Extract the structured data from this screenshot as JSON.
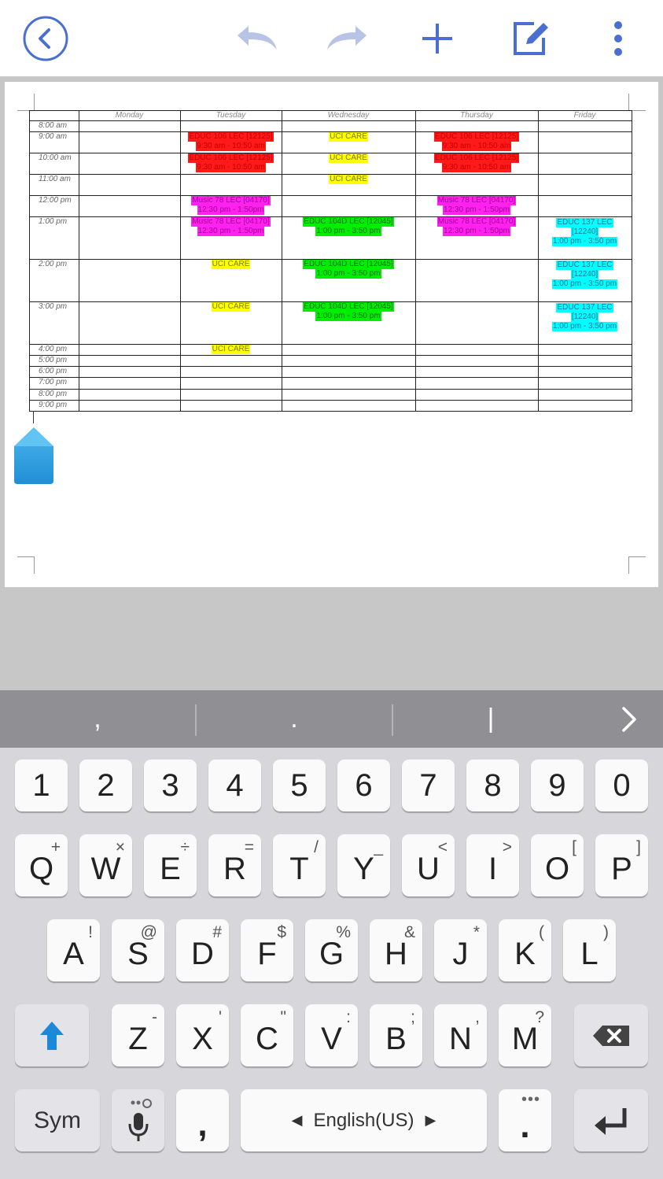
{
  "toolbar": {
    "icons": [
      "back-circle-icon",
      "undo-icon",
      "redo-icon",
      "add-icon",
      "edit-note-icon",
      "more-vert-icon"
    ],
    "accent": "#4a6fd0",
    "disabled": "#b7c4e6"
  },
  "schedule": {
    "days": [
      "Monday",
      "Tuesday",
      "Wednesday",
      "Thursday",
      "Friday"
    ],
    "times": [
      "8:00 am",
      "9:00 am",
      "10:00 am",
      "11:00 am",
      "12:00 pm",
      "1:00 pm",
      "2:00 pm",
      "3:00 pm",
      "4:00 pm",
      "5:00 pm",
      "6:00 pm",
      "7:00 pm",
      "8:00 pm",
      "9:00 pm"
    ],
    "events": {
      "tue_9_l1": "EDUC 106 LEC [12125]",
      "tue_9_l2": "9:30 am  -  10:50 am",
      "tue_10_l1": "EDUC 106 LEC [12125]",
      "tue_10_l2": "9:30 am  -  10:50 am",
      "tue_12_l1": "Music 78 LEC [04170]",
      "tue_12_l2": "12:30 pm  -  1:50pm",
      "tue_1_l1": "Music 78 LEC [04170]",
      "tue_1_l2": "12:30 pm  -  1:50pm",
      "tue_2": "UCI CARE",
      "tue_3": "UCI CARE",
      "tue_4": "UCI CARE",
      "wed_9": "UCI CARE",
      "wed_10": "UCI CARE",
      "wed_11": "UCI CARE",
      "wed_1_l1": "EDUC 104D LEC [12045]",
      "wed_1_l2": "1:00 pm  -  3:50 pm",
      "wed_2_l1": "EDUC 104D LEC [12045]",
      "wed_2_l2": "1:00 pm  -  3:50 pm",
      "wed_3_l1": "EDUC 104D LEC [12045]",
      "wed_3_l2": "1:00 pm  -  3:50 pm",
      "thu_9_l1": "EDUC 106 LEC [12125]",
      "thu_9_l2": "9:30 am  -  10:50 am",
      "thu_10_l1": "EDUC 106 LEC [12125]",
      "thu_10_l2": "9:30 am  -  10:50 am",
      "thu_12_l1": "Music 78 LEC [04170]",
      "thu_12_l2": "12:30 pm  -  1:50pm",
      "thu_1_l1": "Music 78 LEC [04170]",
      "thu_1_l2": "12:30 pm  -  1:50pm",
      "fri_1_l1": "EDUC 137 LEC",
      "fri_1_l2": "[12240]",
      "fri_1_l3": "1:00 pm  -  3:50 pm",
      "fri_2_l1": "EDUC 137 LEC",
      "fri_2_l2": "[12240]",
      "fri_2_l3": "1:00 pm  -  3:50 pm",
      "fri_3_l1": "EDUC 137 LEC",
      "fri_3_l2": "[12240]",
      "fri_3_l3": "1:00 pm  -  3:50 pm"
    },
    "colors": {
      "red": "#ff1a1a",
      "yellow": "#ffff00",
      "magenta": "#ff22ee",
      "green": "#00ee00",
      "cyan": "#00ffff"
    }
  },
  "keyboard": {
    "suggestions": [
      ",",
      ".",
      "|"
    ],
    "suggest_more_icon": "chevron-right-icon",
    "numbers": [
      "1",
      "2",
      "3",
      "4",
      "5",
      "6",
      "7",
      "8",
      "9",
      "0"
    ],
    "row1": [
      {
        "main": "Q",
        "sub": "+"
      },
      {
        "main": "W",
        "sub": "×"
      },
      {
        "main": "E",
        "sub": "÷"
      },
      {
        "main": "R",
        "sub": "="
      },
      {
        "main": "T",
        "sub": "/"
      },
      {
        "main": "Y",
        "sub": "_"
      },
      {
        "main": "U",
        "sub": "<"
      },
      {
        "main": "I",
        "sub": ">"
      },
      {
        "main": "O",
        "sub": "["
      },
      {
        "main": "P",
        "sub": "]"
      }
    ],
    "row2": [
      {
        "main": "A",
        "sub": "!"
      },
      {
        "main": "S",
        "sub": "@"
      },
      {
        "main": "D",
        "sub": "#"
      },
      {
        "main": "F",
        "sub": "$"
      },
      {
        "main": "G",
        "sub": "%"
      },
      {
        "main": "H",
        "sub": "&"
      },
      {
        "main": "J",
        "sub": "*"
      },
      {
        "main": "K",
        "sub": "("
      },
      {
        "main": "L",
        "sub": ")"
      }
    ],
    "row3": [
      {
        "main": "Z",
        "sub": "-"
      },
      {
        "main": "X",
        "sub": "'"
      },
      {
        "main": "C",
        "sub": "\""
      },
      {
        "main": "V",
        "sub": ":"
      },
      {
        "main": "B",
        "sub": ";"
      },
      {
        "main": "N",
        "sub": ","
      },
      {
        "main": "M",
        "sub": "?"
      }
    ],
    "sym_label": "Sym",
    "comma_label": ",",
    "space_label": "English(US)",
    "period_label": ".",
    "shift_icon": "shift-up-arrow-icon",
    "backspace_icon": "backspace-icon",
    "enter_icon": "enter-icon",
    "mic_icon": "microphone-icon"
  }
}
